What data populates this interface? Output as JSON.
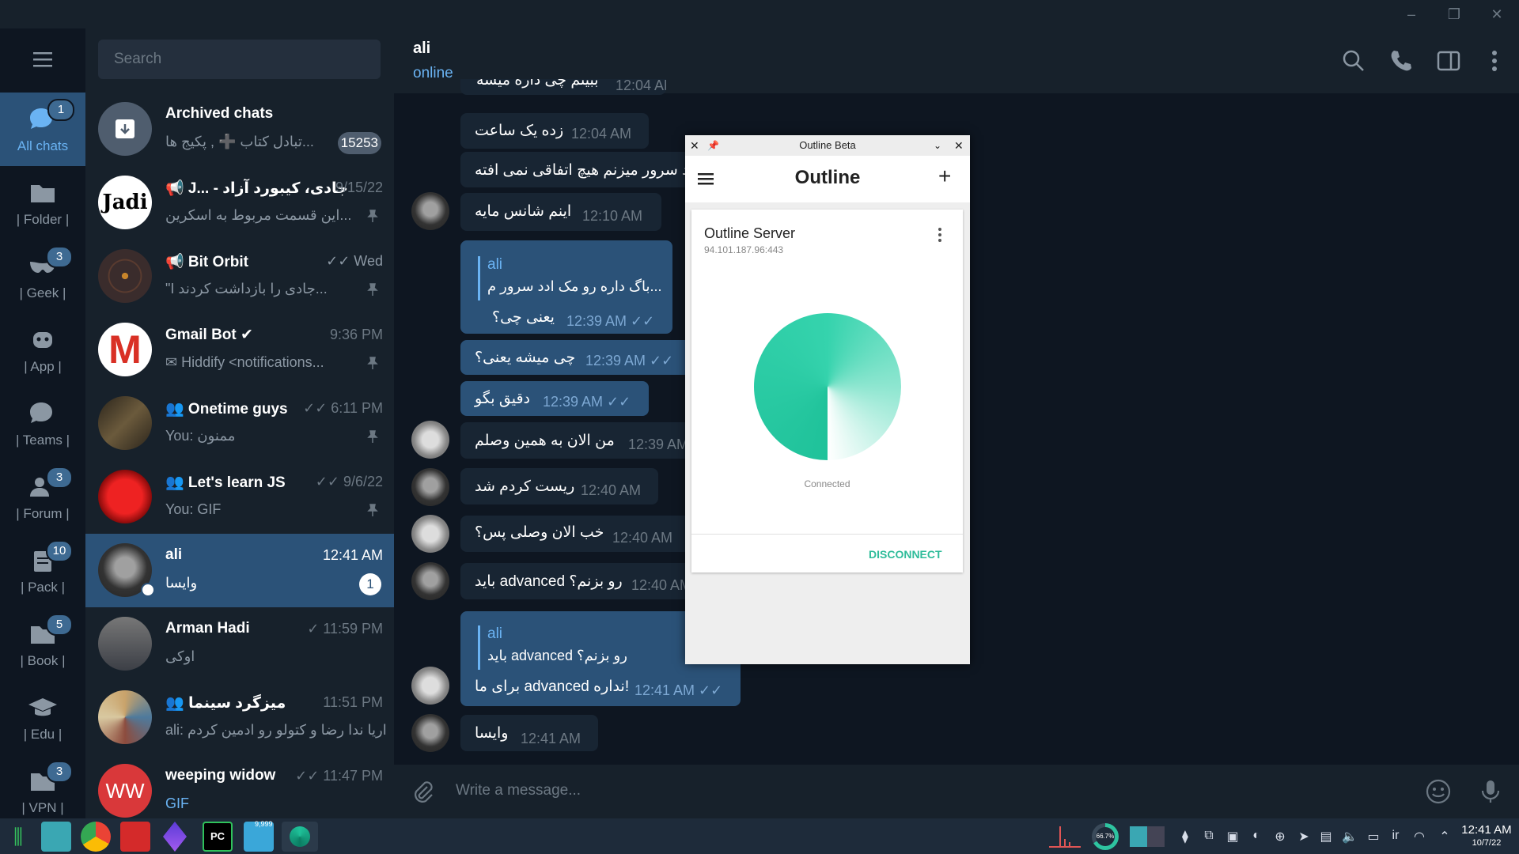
{
  "window": {
    "minimize": "–",
    "maximize": "❐",
    "close": "✕"
  },
  "rail": [
    {
      "label": "All chats",
      "badge": "1",
      "icon": "chats-icon",
      "active": true
    },
    {
      "label": "| Folder |",
      "badge": "",
      "icon": "folder-icon"
    },
    {
      "label": "| Geek |",
      "badge": "3",
      "icon": "mask-icon"
    },
    {
      "label": "| App |",
      "badge": "",
      "icon": "robot-icon"
    },
    {
      "label": "| Teams |",
      "badge": "",
      "icon": "chats-icon"
    },
    {
      "label": "| Forum |",
      "badge": "3",
      "icon": "users-icon"
    },
    {
      "label": "| Pack |",
      "badge": "10",
      "icon": "clipboard-icon"
    },
    {
      "label": "| Book |",
      "badge": "5",
      "icon": "folder-icon"
    },
    {
      "label": "| Edu |",
      "badge": "",
      "icon": "graduation-cap-icon"
    },
    {
      "label": "| VPN |",
      "badge": "3",
      "icon": "folder-icon"
    }
  ],
  "search": {
    "placeholder": "Search"
  },
  "chats": [
    {
      "name": "Archived chats",
      "time": "",
      "preview": "تبادل کتاب ➕ , پکیج ها...",
      "count": "15253",
      "avatar_color": "#4f5d6e",
      "avatar_text": ""
    },
    {
      "name": "📢 J... - جادی، کیبورد آزاد",
      "time": "9/15/22",
      "preview": "این قسمت مربوط به اسکرین...",
      "avatar_color": "#ffffff",
      "avatar_text": "Jadi"
    },
    {
      "name": "📢 Bit Orbit",
      "time": "✓✓ Wed",
      "preview": "\"I جادی را بازداشت کردند...",
      "avatar_color": "#3a2c2c",
      "avatar_text": ""
    },
    {
      "name": "Gmail Bot ✔",
      "time": "9:36 PM",
      "preview": "✉ Hiddify <notifications...",
      "avatar_color": "#ffffff",
      "avatar_text": "M"
    },
    {
      "name": "👥 Onetime guys",
      "time": "✓✓ 6:11 PM",
      "preview": "You: ممنون",
      "avatar_color": "#3d3528",
      "avatar_text": ""
    },
    {
      "name": "👥 Let's learn JS",
      "time": "✓✓ 9/6/22",
      "preview": "You: GIF",
      "avatar_color": "#c91616",
      "avatar_text": ""
    },
    {
      "name": "ali",
      "time": "12:41 AM",
      "preview": "وایسا",
      "count": "1",
      "avatar_color": "#555",
      "avatar_text": "",
      "active": true
    },
    {
      "name": "Arman Hadi",
      "time": "✓ 11:59 PM",
      "preview": "اوکی",
      "avatar_color": "#4a4d55",
      "avatar_text": ""
    },
    {
      "name": "👥 میزگرد سینما",
      "time": "11:51 PM",
      "preview": "ali: اریا ندا رضا و کتولو رو ادمین کردم",
      "avatar_color": "#b9a98a",
      "avatar_text": ""
    },
    {
      "name": "weeping widow",
      "time": "✓✓ 11:47 PM",
      "preview": "GIF",
      "avatar_color": "#d9383a",
      "avatar_text": "WW"
    }
  ],
  "header": {
    "name": "ali",
    "status": "online"
  },
  "messages": [
    {
      "text": "زده یک ساعت",
      "time": "12:04 AM"
    },
    {
      "text": "ادد سرور میزنم هیچ اتفاقی نمی افته",
      "time": ""
    },
    {
      "text": "اینم شانس مایه",
      "time": "12:10 AM"
    },
    {
      "reply_name": "ali",
      "reply_text": "باگ داره رو مک ادد سرور م...",
      "text": "یعنی چی؟",
      "time": "12:39 AM ✓✓"
    },
    {
      "text": "چی میشه یعنی؟",
      "time": "12:39 AM ✓✓"
    },
    {
      "text": "دقیق بگو",
      "time": "12:39 AM ✓✓"
    },
    {
      "text": "من الان به همین وصلم",
      "time": "12:39 AM"
    },
    {
      "text": "ریست کردم شد",
      "time": "12:40 AM"
    },
    {
      "text": "خب الان وصلی پس؟",
      "time": "12:40 AM"
    },
    {
      "text": "باید advanced رو بزنم؟",
      "time": "12:40 AM"
    },
    {
      "reply_name": "ali",
      "reply_text": "باید advanced رو بزنم؟",
      "text": "برای ما advanced نداره!",
      "time": "12:41 AM ✓✓"
    },
    {
      "text": "وایسا",
      "time": "12:41 AM"
    }
  ],
  "partial_top": {
    "text": "ببینم چی داره میشه",
    "time": "12:04 AM"
  },
  "composer": {
    "placeholder": "Write a message..."
  },
  "outline": {
    "window_title": "Outline Beta",
    "app_title": "Outline",
    "server_name": "Outline Server",
    "server_address": "94.101.187.96:443",
    "status": "Connected",
    "disconnect": "DISCONNECT",
    "accent": "#2fbc9a"
  },
  "tray": {
    "time": "12:41 AM",
    "date": "10/7/22",
    "lang": "ir",
    "cpu": "66.7%",
    "notif": "9,999"
  }
}
